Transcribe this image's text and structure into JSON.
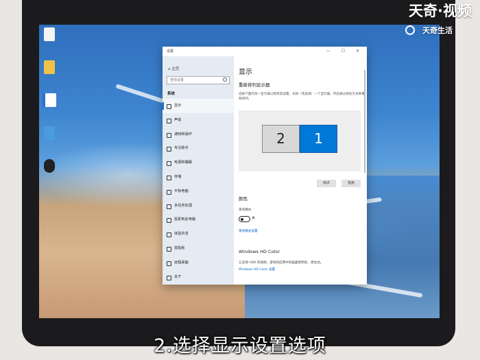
{
  "watermark": {
    "brand": "天奇·视频",
    "brand_small": "天奇生活"
  },
  "caption": "2.选择显示设置选项",
  "window": {
    "title": "设置",
    "controls": "— ☐ ✕"
  },
  "sidebar": {
    "home": "主页",
    "search_placeholder": "查找设置",
    "section": "系统",
    "items": [
      {
        "label": "显示",
        "active": true
      },
      {
        "label": "声音"
      },
      {
        "label": "通知和操作"
      },
      {
        "label": "专注助手"
      },
      {
        "label": "电源和睡眠"
      },
      {
        "label": "存储"
      },
      {
        "label": "平板电脑"
      },
      {
        "label": "多任务处理"
      },
      {
        "label": "投影到此电脑"
      },
      {
        "label": "体验共享"
      },
      {
        "label": "剪贴板"
      },
      {
        "label": "远程桌面"
      },
      {
        "label": "关于"
      }
    ]
  },
  "main": {
    "title": "显示",
    "arrange_heading": "重新排列显示器",
    "arrange_desc": "选择下面的某一显示器以更改其设置。长按（或选择）一个显示器，然后通过拖动方式来重新排列。",
    "monitor_2": "2",
    "monitor_1": "1",
    "identify_button": "标识",
    "detect_button": "检测",
    "color_heading": "颜色",
    "night_light_label": "夜间模式",
    "night_light_state": "关",
    "night_light_link": "夜间模式设置",
    "hdr_heading": "Windows HD Color",
    "hdr_desc": "让支持 HDR 的视频、游戏和应用中的画面更明亮、更生动。",
    "hdr_link": "Windows HD Color 设置"
  },
  "desktop": {
    "icons": [
      "回收站",
      "",
      "",
      "",
      "",
      ""
    ]
  }
}
